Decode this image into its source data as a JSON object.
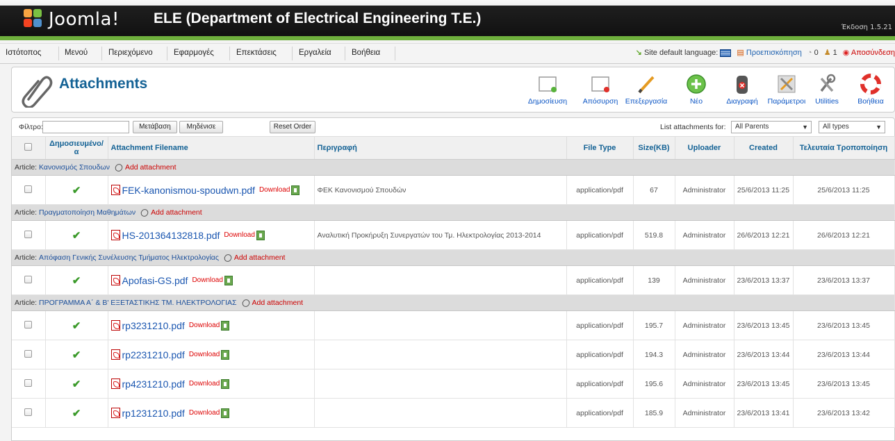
{
  "header": {
    "brand": "Joomla!",
    "site_name": "ELE (Department of Electrical Engineering T.E.)",
    "version": "Έκδοση 1.5.21"
  },
  "menu": {
    "items": [
      "Ιστότοπος",
      "Μενού",
      "Περιεχόμενο",
      "Εφαρμογές",
      "Επεκτάσεις",
      "Εργαλεία",
      "Βοήθεια"
    ],
    "site_language_label": "Site default language:",
    "preview": "Προεπισκόπηση",
    "messages_count": "0",
    "users_count": "1",
    "logout": "Αποσύνδεση"
  },
  "toolbar": {
    "title": "Attachments",
    "buttons": [
      "Δημοσίευση",
      "Απόσυρση",
      "Επεξεργασία",
      "Νέο",
      "Διαγραφή",
      "Παράμετροι",
      "Utilities",
      "Βοήθεια"
    ]
  },
  "filter": {
    "label": "Φίλτρο:",
    "value": "",
    "go": "Μετάβαση",
    "reset": "Μηδένισε",
    "reset_order": "Reset Order",
    "list_for_label": "List attachments for:",
    "parents_selected": "All Parents",
    "types_selected": "All types"
  },
  "table": {
    "columns": [
      "Δημοσιευμένο/α",
      "Attachment Filename",
      "Περιγραφή",
      "File Type",
      "Size(KB)",
      "Uploader",
      "Created",
      "Τελευταία Τροποποίηση"
    ],
    "download_label": "Download",
    "article_prefix": "Article:",
    "add_attachment": "Add attachment",
    "groups": [
      {
        "article": "Κανονισμός Σπουδων",
        "rows": [
          {
            "file": "FEK-kanonismou-spoudwn.pdf",
            "desc": "ΦΕΚ Κανονισμού Σπουδών",
            "type": "application/pdf",
            "size": "67",
            "uploader": "Administrator",
            "created": "25/6/2013 11:25",
            "modified": "25/6/2013 11:25"
          }
        ]
      },
      {
        "article": "Πραγματοποίηση Μαθημάτων",
        "rows": [
          {
            "file": "HS-201364132818.pdf",
            "desc": "Αναλυτική Προκήρυξη Συνεργατών του Τμ. Ηλεκτρολογίας 2013-2014",
            "type": "application/pdf",
            "size": "519.8",
            "uploader": "Administrator",
            "created": "26/6/2013 12:21",
            "modified": "26/6/2013 12:21"
          }
        ]
      },
      {
        "article": "Απόφαση Γενικής Συνέλευσης Τμήματος Ηλεκτρολογίας",
        "rows": [
          {
            "file": "Apofasi-GS.pdf",
            "desc": "",
            "type": "application/pdf",
            "size": "139",
            "uploader": "Administrator",
            "created": "23/6/2013 13:37",
            "modified": "23/6/2013 13:37"
          }
        ]
      },
      {
        "article": "ΠΡΟΓΡΑΜΜΑ Α΄ & Β' ΕΞΕΤΑΣΤΙΚΗΣ ΤΜ. ΗΛΕΚΤΡΟΛΟΓΙΑΣ",
        "rows": [
          {
            "file": "rp3231210.pdf",
            "desc": "",
            "type": "application/pdf",
            "size": "195.7",
            "uploader": "Administrator",
            "created": "23/6/2013 13:45",
            "modified": "23/6/2013 13:45"
          },
          {
            "file": "rp2231210.pdf",
            "desc": "",
            "type": "application/pdf",
            "size": "194.3",
            "uploader": "Administrator",
            "created": "23/6/2013 13:44",
            "modified": "23/6/2013 13:44"
          },
          {
            "file": "rp4231210.pdf",
            "desc": "",
            "type": "application/pdf",
            "size": "195.6",
            "uploader": "Administrator",
            "created": "23/6/2013 13:45",
            "modified": "23/6/2013 13:45"
          },
          {
            "file": "rp1231210.pdf",
            "desc": "",
            "type": "application/pdf",
            "size": "185.9",
            "uploader": "Administrator",
            "created": "23/6/2013 13:41",
            "modified": "23/6/2013 13:42"
          }
        ]
      }
    ]
  }
}
